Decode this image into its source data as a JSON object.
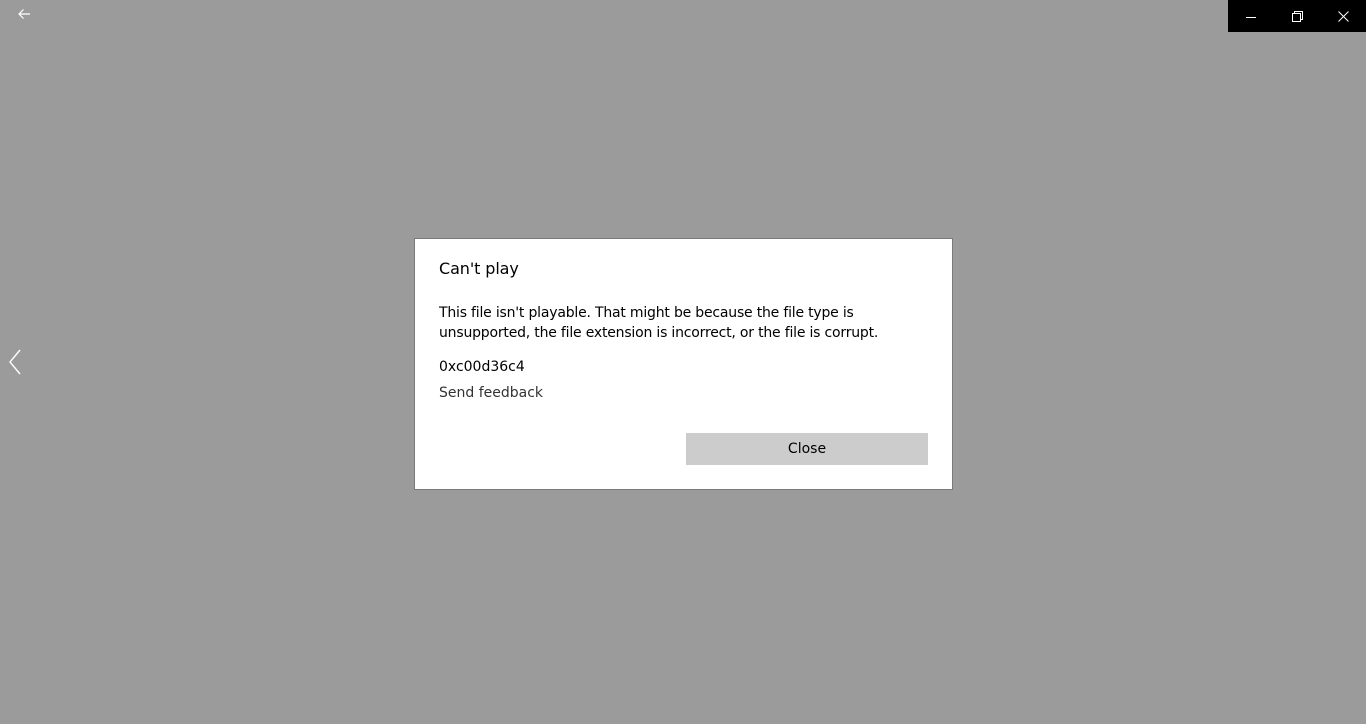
{
  "app": {
    "back_icon": "arrow-left-icon",
    "previous_icon": "chevron-left-icon"
  },
  "window_controls": {
    "minimize_icon": "minimize-icon",
    "restore_icon": "restore-icon",
    "close_icon": "close-icon"
  },
  "dialog": {
    "title": "Can't play",
    "message": "This file isn't playable. That might be because the file type is unsupported, the file extension is incorrect, or the file is corrupt.",
    "error_code": "0xc00d36c4",
    "feedback_label": "Send feedback",
    "close_label": "Close"
  },
  "colors": {
    "background": "#9b9b9b",
    "titlebar_controls": "#000000",
    "button": "#cccccc"
  }
}
